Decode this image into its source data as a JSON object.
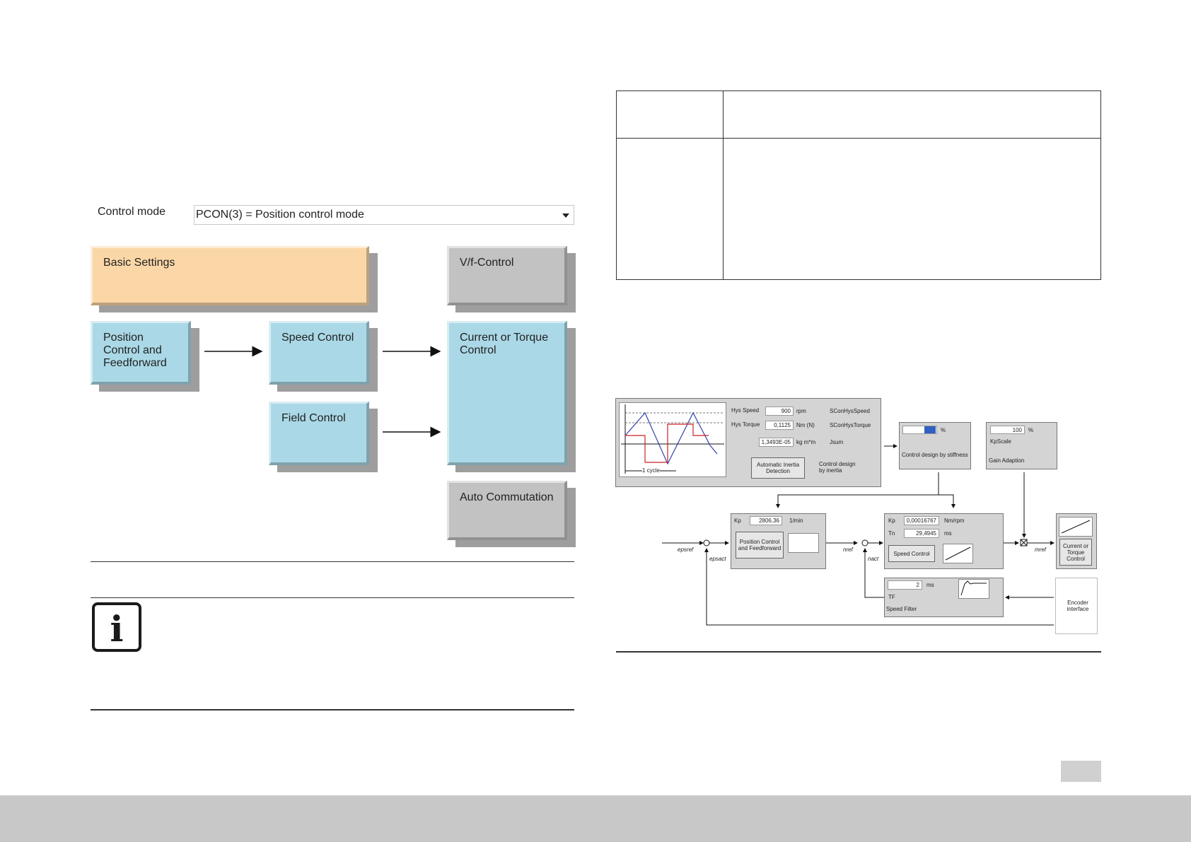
{
  "control_mode": {
    "label": "Control mode",
    "selected": "PCON(3) = Position control mode"
  },
  "blocks": {
    "basic_settings": "Basic Settings",
    "vf_control": "V/f-Control",
    "position_control": "Position Control and Feedforward",
    "speed_control": "Speed Control",
    "current_control": "Current or Torque Control",
    "field_control": "Field Control",
    "auto_commutation": "Auto Commutation"
  },
  "diagram": {
    "cycle_label": "1 cycle",
    "hys_speed_label": "Hys Speed",
    "hys_speed_value": "900",
    "hys_speed_unit": "rpm",
    "hys_speed_param": "SConHysSpeed",
    "hys_torque_label": "Hys Torque",
    "hys_torque_value": "0,1125",
    "hys_torque_unit": "Nm (N)",
    "hys_torque_param": "SConHysTorque",
    "jsum_value": "1,3493E-05",
    "jsum_unit": "kg m*m",
    "jsum_param": "Jsum",
    "auto_inertia_button": "Automatic Inertia Detection",
    "control_design_inertia": "Control design by inertia",
    "stiffness_value": "100",
    "stiffness_unit": "%",
    "stiffness_label": "Control design by stiffness",
    "kpscale_value": "100",
    "kpscale_unit": "%",
    "kpscale_label": "KpScale",
    "gain_adaption_label": "Gain Adaption",
    "pos_kp_label": "Kp",
    "pos_kp_value": "2806,36",
    "pos_kp_unit": "1/min",
    "pos_button": "Position Control and Feedforward",
    "spd_kp_label": "Kp",
    "spd_kp_value": "0,00016767",
    "spd_kp_unit": "Nm/rpm",
    "spd_tn_label": "Tn",
    "spd_tn_value": "29,4945",
    "spd_tn_unit": "ms",
    "speed_button": "Speed Control",
    "current_button": "Current or Torque Control",
    "tf_value": "2",
    "tf_unit": "ms",
    "tf_label": "TF",
    "speed_filter_label": "Speed Filter",
    "encoder_label": "Encoder interface",
    "sig_epsref": "epsref",
    "sig_epsact": "epsact",
    "sig_nref": "nref",
    "sig_nact": "nact",
    "sig_mref": "mref"
  }
}
